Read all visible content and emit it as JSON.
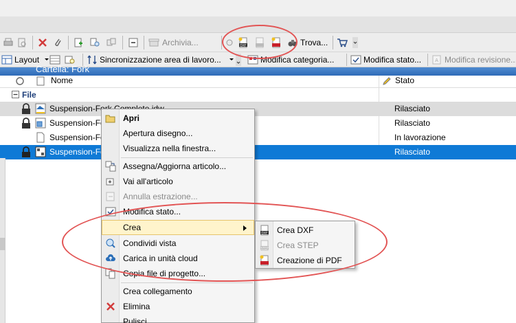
{
  "toolbar1": {
    "archivia": "Archivia...",
    "trova": "Trova..."
  },
  "toolbar2": {
    "layout": "Layout",
    "sync": "Sincronizzazione area di lavoro...",
    "modifica_categoria": "Modifica categoria...",
    "modifica_stato": "Modifica stato...",
    "modifica_revisione": "Modifica revisione..."
  },
  "pane_title": "Cartella: Fork",
  "columns": {
    "nome": "Nome",
    "stato": "Stato"
  },
  "group": {
    "label": "File"
  },
  "rows": [
    {
      "name": "Suspension-Fork Complete.idw",
      "status": "Rilasciato"
    },
    {
      "name": "Suspension-Fo",
      "status": "Rilasciato"
    },
    {
      "name": "Suspension-Fo",
      "status": "In lavorazione"
    },
    {
      "name": "Suspension-Fo",
      "status": "Rilasciato"
    }
  ],
  "context_menu": {
    "apri": "Apri",
    "apertura_disegno": "Apertura disegno...",
    "visualizza": "Visualizza nella finestra...",
    "assegna": "Assegna/Aggiorna articolo...",
    "vai_articolo": "Vai all'articolo",
    "annulla_estrazione": "Annulla estrazione...",
    "modifica_stato": "Modifica stato...",
    "crea": "Crea",
    "condividi": "Condividi vista",
    "carica_cloud": "Carica in unità cloud",
    "copia_file": "Copia file di progetto...",
    "crea_collegamento": "Crea collegamento",
    "elimina": "Elimina",
    "pulisci": "Pulisci..."
  },
  "submenu": {
    "crea_dxf": "Crea DXF",
    "crea_step": "Crea STEP",
    "creazione_pdf": "Creazione di PDF"
  },
  "colors": {
    "selection": "#0f7ad6",
    "menu_highlight": "#fff4cc",
    "annotation": "#e25454",
    "pane_title_bar": "#2f6bb8"
  }
}
